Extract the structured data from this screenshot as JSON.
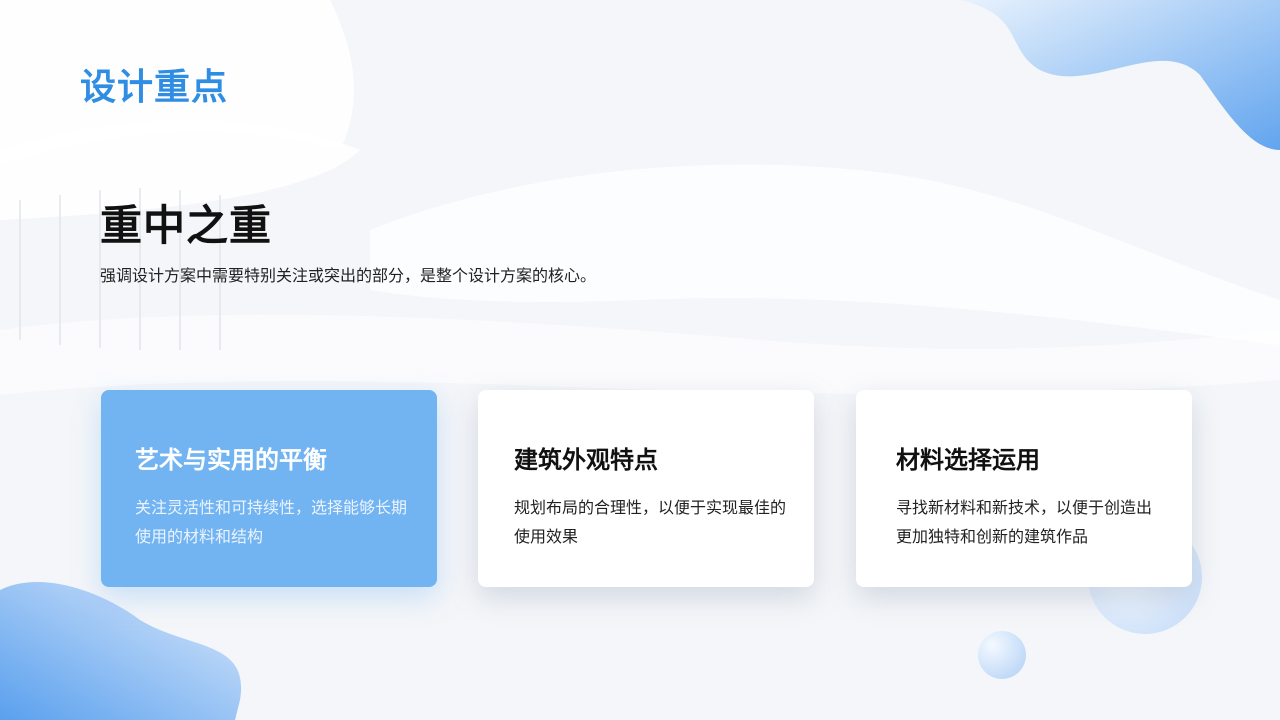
{
  "slide": {
    "title": "设计重点"
  },
  "hero": {
    "headline": "重中之重",
    "description": "强调设计方案中需要特别关注或突出的部分，是整个设计方案的核心。"
  },
  "cards": [
    {
      "title": "艺术与实用的平衡",
      "body": "关注灵活性和可持续性，选择能够长期使用的材料和结构",
      "highlighted": true
    },
    {
      "title": "建筑外观特点",
      "body": "规划布局的合理性，以便于实现最佳的使用效果",
      "highlighted": false
    },
    {
      "title": "材料选择运用",
      "body": "寻找新材料和新技术，以便于创造出更加独特和创新的建筑作品",
      "highlighted": false
    }
  ],
  "colors": {
    "accent": "#2f8de4",
    "card_highlight": "#72b3f1",
    "background": "#f4f6f9"
  }
}
